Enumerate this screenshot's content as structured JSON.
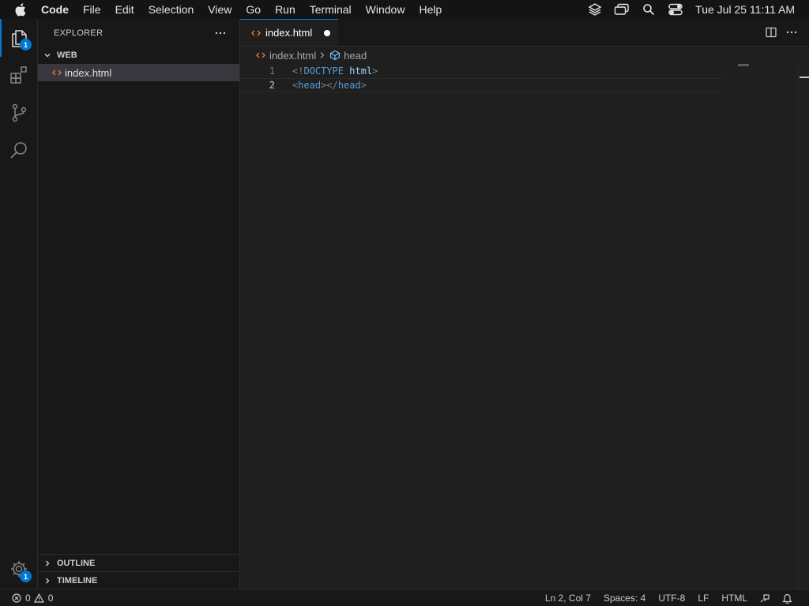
{
  "menubar": {
    "app_name": "Code",
    "items": [
      "File",
      "Edit",
      "Selection",
      "View",
      "Go",
      "Run",
      "Terminal",
      "Window",
      "Help"
    ],
    "clock": "Tue Jul 25  11:11 AM"
  },
  "activity_bar": {
    "explorer_badge": "1",
    "settings_badge": "1"
  },
  "sidebar": {
    "title": "EXPLORER",
    "folder": "WEB",
    "files": [
      "index.html"
    ],
    "sections": [
      "OUTLINE",
      "TIMELINE"
    ]
  },
  "editor": {
    "tab": {
      "label": "index.html",
      "modified": true
    },
    "breadcrumb": {
      "file": "index.html",
      "symbol": "head"
    },
    "lines": [
      {
        "number": "1",
        "parts": [
          [
            "punct",
            "<!"
          ],
          [
            "tag",
            "DOCTYPE"
          ],
          [
            "plain",
            " "
          ],
          [
            "attr",
            "html"
          ],
          [
            "punct",
            ">"
          ]
        ]
      },
      {
        "number": "2",
        "parts": [
          [
            "punct",
            "<"
          ],
          [
            "tag",
            "head"
          ],
          [
            "punct",
            "></"
          ],
          [
            "tag",
            "head"
          ],
          [
            "punct",
            ">"
          ]
        ]
      }
    ]
  },
  "statusbar": {
    "errors": "0",
    "warnings": "0",
    "position": "Ln 2, Col 7",
    "spaces": "Spaces: 4",
    "encoding": "UTF-8",
    "eol": "LF",
    "language": "HTML"
  },
  "colors": {
    "accent": "#0078d4",
    "html_file_icon": "#e37933",
    "tag": "#569cd6",
    "attr": "#9cdcfe"
  }
}
